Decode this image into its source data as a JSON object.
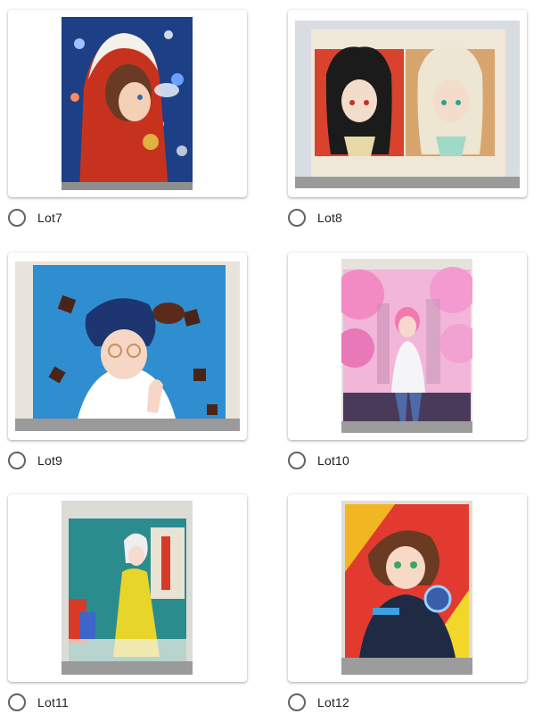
{
  "options": [
    {
      "label": "Lot7",
      "selected": false,
      "image": "red-hood-girl-painting"
    },
    {
      "label": "Lot8",
      "selected": false,
      "image": "two-snake-hair-girls-painting"
    },
    {
      "label": "Lot9",
      "selected": false,
      "image": "chocolate-girl-painting"
    },
    {
      "label": "Lot10",
      "selected": false,
      "image": "cherry-blossom-city-girl-painting"
    },
    {
      "label": "Lot11",
      "selected": false,
      "image": "yellow-coat-girl-painting"
    },
    {
      "label": "Lot12",
      "selected": false,
      "image": "robot-suit-girl-painting"
    }
  ],
  "colors": {
    "radio_border": "#5f6368",
    "label_text": "#202124",
    "card_bg": "#ffffff"
  }
}
